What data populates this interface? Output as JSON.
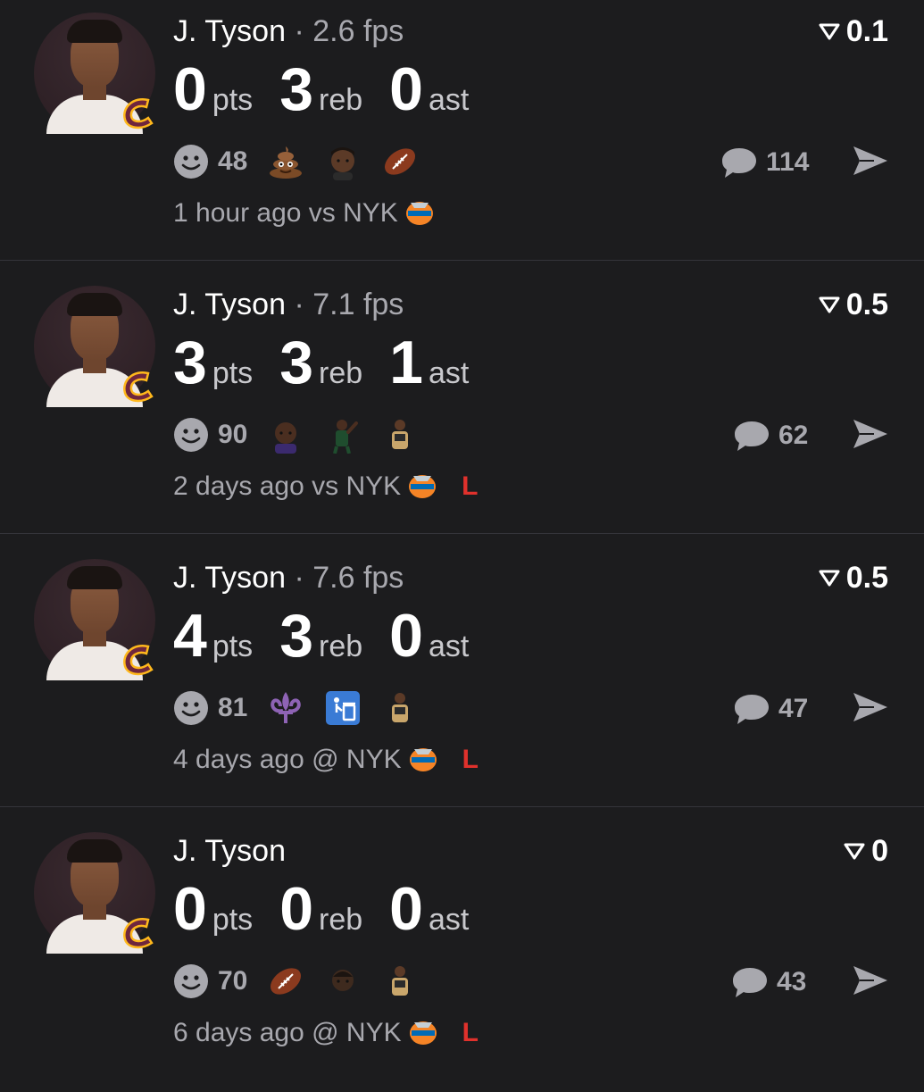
{
  "feed": [
    {
      "player": "J. Tyson",
      "fps": "· 2.6 fps",
      "score": "0.1",
      "stats": [
        {
          "value": "0",
          "unit": "pts"
        },
        {
          "value": "3",
          "unit": "reb"
        },
        {
          "value": "0",
          "unit": "ast"
        }
      ],
      "reaction_count": "48",
      "reactions": [
        "poop-emoji",
        "player-face-icon",
        "football-emoji"
      ],
      "comment_count": "114",
      "time": "1 hour ago vs NYK",
      "result": ""
    },
    {
      "player": "J. Tyson",
      "fps": "· 7.1 fps",
      "score": "0.5",
      "stats": [
        {
          "value": "3",
          "unit": "pts"
        },
        {
          "value": "3",
          "unit": "reb"
        },
        {
          "value": "1",
          "unit": "ast"
        }
      ],
      "reaction_count": "90",
      "reactions": [
        "player-face-icon",
        "player-shooting-icon",
        "player-standing-icon"
      ],
      "comment_count": "62",
      "time": "2 days ago vs NYK",
      "result": "L"
    },
    {
      "player": "J. Tyson",
      "fps": "· 7.6 fps",
      "score": "0.5",
      "stats": [
        {
          "value": "4",
          "unit": "pts"
        },
        {
          "value": "3",
          "unit": "reb"
        },
        {
          "value": "0",
          "unit": "ast"
        }
      ],
      "reaction_count": "81",
      "reactions": [
        "fleur-de-lis-emoji",
        "trash-can-emoji",
        "player-standing-icon"
      ],
      "comment_count": "47",
      "time": "4 days ago @ NYK",
      "result": "L"
    },
    {
      "player": "J. Tyson",
      "fps": "",
      "score": "0",
      "stats": [
        {
          "value": "0",
          "unit": "pts"
        },
        {
          "value": "0",
          "unit": "reb"
        },
        {
          "value": "0",
          "unit": "ast"
        }
      ],
      "reaction_count": "70",
      "reactions": [
        "football-emoji",
        "player-face-icon",
        "player-standing-icon"
      ],
      "comment_count": "43",
      "time": "6 days ago @ NYK",
      "result": "L"
    }
  ],
  "colors": {
    "background": "#1c1c1e",
    "muted_text": "#a8a8ae",
    "loss": "#e0312c",
    "cavs_wine": "#6f263d",
    "cavs_gold": "#ffb81c"
  }
}
